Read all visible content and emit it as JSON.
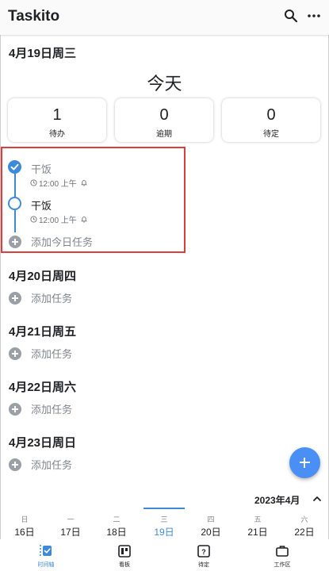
{
  "app": {
    "title": "Taskito"
  },
  "today_section": {
    "date_heading": "4月19日周三",
    "title": "今天",
    "stats": [
      {
        "value": "1",
        "label": "待办"
      },
      {
        "value": "0",
        "label": "逾期"
      },
      {
        "value": "0",
        "label": "待定"
      }
    ],
    "tasks": [
      {
        "title": "干饭",
        "time": "12:00 上午",
        "status": "done"
      },
      {
        "title": "干饭",
        "time": "12:00 上午",
        "status": "open"
      }
    ],
    "add_label": "添加今日任务"
  },
  "days": [
    {
      "date_heading": "4月20日周四",
      "add_label": "添加任务"
    },
    {
      "date_heading": "4月21日周五",
      "add_label": "添加任务"
    },
    {
      "date_heading": "4月22日周六",
      "add_label": "添加任务"
    },
    {
      "date_heading": "4月23日周日",
      "add_label": "添加任务"
    }
  ],
  "calendar": {
    "month_label": "2023年4月",
    "week": [
      {
        "weekday": "日",
        "date": "16日"
      },
      {
        "weekday": "一",
        "date": "17日"
      },
      {
        "weekday": "二",
        "date": "18日"
      },
      {
        "weekday": "三",
        "date": "19日",
        "selected": true
      },
      {
        "weekday": "四",
        "date": "20日"
      },
      {
        "weekday": "五",
        "date": "21日"
      },
      {
        "weekday": "六",
        "date": "22日"
      }
    ]
  },
  "bottom_nav": [
    {
      "label": "时间轴",
      "icon": "timeline-icon",
      "active": true
    },
    {
      "label": "看板",
      "icon": "board-icon"
    },
    {
      "label": "待定",
      "icon": "pending-icon"
    },
    {
      "label": "工作区",
      "icon": "workspace-icon"
    }
  ],
  "colors": {
    "accent": "#3d8ad9",
    "fab": "#4a8ff5",
    "highlight": "#d93f3f"
  }
}
